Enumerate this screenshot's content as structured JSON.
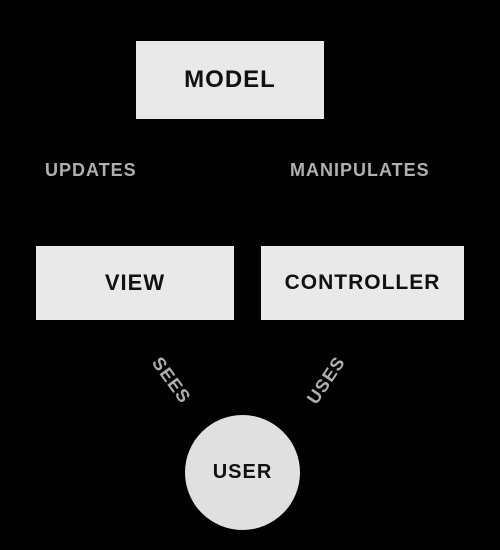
{
  "nodes": {
    "model": "MODEL",
    "view": "VIEW",
    "controller": "CONTROLLER",
    "user": "USER"
  },
  "edges": {
    "updates": "UPDATES",
    "manipulates": "MANIPULATES",
    "sees": "SEES",
    "uses": "USES"
  },
  "colors": {
    "background": "#000000",
    "node_fill": "#e9e9e9",
    "user_fill": "#e0e0e0",
    "node_text": "#111111",
    "edge_text": "#b0b0b0"
  }
}
